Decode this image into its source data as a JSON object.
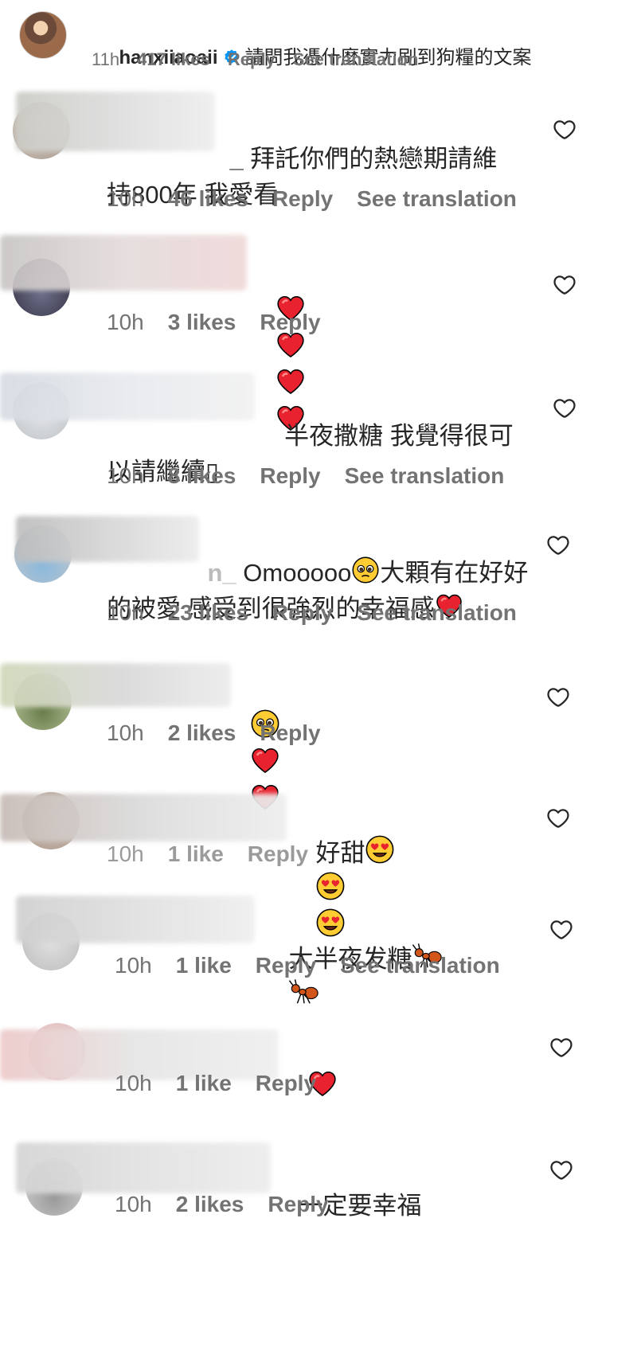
{
  "top": {
    "username": "hanxiiaoaii",
    "caption": "請問我憑什麼實力刷到狗糧的文案",
    "time": "11h",
    "likes": "417 likes",
    "reply": "Reply",
    "see_translation": "See translation"
  },
  "comments": [
    {
      "user": "_",
      "text": "拜託你們的熱戀期請維持800年 我愛看",
      "time": "10h",
      "likes": "46 likes",
      "reply": "Reply",
      "see_translation": "See translation"
    },
    {
      "user": "",
      "text": "",
      "emojis": [
        "red-heart",
        "red-heart",
        "red-heart",
        "red-heart"
      ],
      "time": "10h",
      "likes": "3 likes",
      "reply": "Reply"
    },
    {
      "user": "",
      "text": "半夜撒糖 我覺得很可以請繼續▯",
      "time": "10h",
      "likes": "8 likes",
      "reply": "Reply",
      "see_translation": "See translation"
    },
    {
      "user": "n_",
      "text": "Omooooo",
      "text2": "大顆有在好好的被愛 感受到很強烈的幸福感",
      "time": "10h",
      "likes": "23 likes",
      "reply": "Reply",
      "see_translation": "See translation"
    },
    {
      "user": "",
      "emojis": [
        "pleading-face",
        "red-heart",
        "red-heart"
      ],
      "time": "10h",
      "likes": "2 likes",
      "reply": "Reply"
    },
    {
      "user": "",
      "text": "好甜",
      "emojis": [
        "heart-eyes",
        "heart-eyes",
        "heart-eyes"
      ],
      "time": "10h",
      "likes": "1 like",
      "reply": "Reply"
    },
    {
      "user": "",
      "text": "大半夜发糖",
      "emojis": [
        "ant",
        "ant"
      ],
      "time": "10h",
      "likes": "1 like",
      "reply": "Reply",
      "see_translation": "See translation"
    },
    {
      "user": "",
      "emojis": [
        "red-heart"
      ],
      "time": "10h",
      "likes": "1 like",
      "reply": "Reply"
    },
    {
      "user": "",
      "text": "一定要幸福",
      "time": "10h",
      "likes": "2 likes",
      "reply": "Reply"
    }
  ],
  "colors": {
    "text": "#262626",
    "meta": "#737373",
    "verified": "#0095f6",
    "heart": "#ed2c3a"
  }
}
